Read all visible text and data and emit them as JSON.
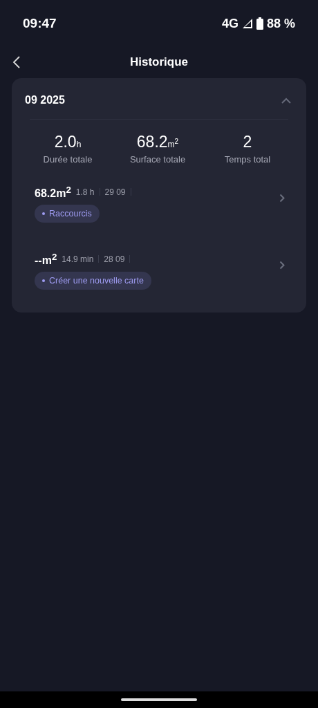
{
  "status_bar": {
    "time": "09:47",
    "network": "4G",
    "battery": "88 %"
  },
  "header": {
    "title": "Historique"
  },
  "month": {
    "label": "09 2025",
    "expanded": true,
    "stats": [
      {
        "value": "2.0",
        "unit": "h",
        "label": "Durée totale"
      },
      {
        "value": "68.2",
        "unit": "m$^{2}$",
        "label": "Surface totale"
      },
      {
        "value": "2",
        "label": "Temps total"
      }
    ],
    "records": [
      {
        "area": "68.2m$^{2}$",
        "duration": "1.8 h",
        "date": "29 09",
        "tag": "Raccourcis"
      },
      {
        "area": "--m$^{2}$",
        "duration": "14.9 min",
        "date": "28 09",
        "tag": "Créer une nouvelle carte"
      }
    ]
  }
}
